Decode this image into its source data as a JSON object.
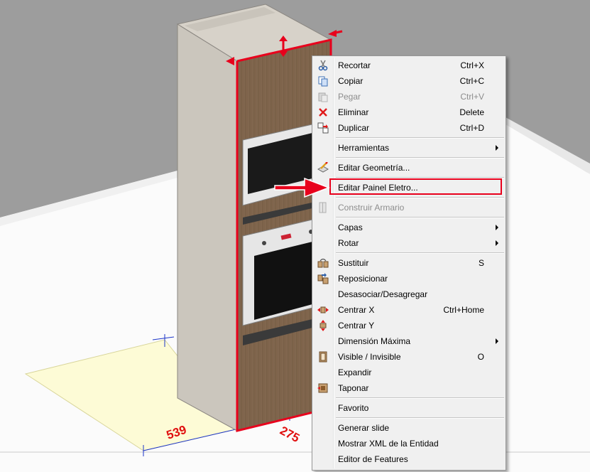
{
  "scene": {
    "dimension_width": "539",
    "dimension_depth": "275",
    "colors": {
      "highlight": "#e8001c",
      "menu_bg": "#f0f0f0"
    }
  },
  "menu": {
    "items": [
      {
        "label": "Recortar",
        "shortcut": "Ctrl+X",
        "icon": "scissors-icon"
      },
      {
        "label": "Copiar",
        "shortcut": "Ctrl+C",
        "icon": "copy-icon"
      },
      {
        "label": "Pegar",
        "shortcut": "Ctrl+V",
        "icon": "paste-icon",
        "disabled": true
      },
      {
        "label": "Eliminar",
        "shortcut": "Delete",
        "icon": "delete-icon"
      },
      {
        "label": "Duplicar",
        "shortcut": "Ctrl+D",
        "icon": "duplicate-icon"
      },
      {
        "label": "Herramientas",
        "submenu": true
      },
      {
        "label": "Editar Geometría...",
        "icon": "edit-geometry-icon"
      },
      {
        "label": "Editar Painel Eletro...",
        "highlighted": true
      },
      {
        "label": "Construir Armario",
        "icon": "build-cabinet-icon",
        "disabled": true
      },
      {
        "label": "Capas",
        "submenu": true
      },
      {
        "label": "Rotar",
        "submenu": true
      },
      {
        "label": "Sustituir",
        "shortcut": "S",
        "icon": "replace-icon"
      },
      {
        "label": "Reposicionar",
        "icon": "reposition-icon"
      },
      {
        "label": "Desasociar/Desagregar"
      },
      {
        "label": "Centrar X",
        "shortcut": "Ctrl+Home",
        "icon": "center-x-icon"
      },
      {
        "label": "Centrar Y",
        "icon": "center-y-icon"
      },
      {
        "label": "Dimensión Máxima",
        "submenu": true
      },
      {
        "label": "Visible / Invisible",
        "shortcut": "O",
        "icon": "visibility-icon"
      },
      {
        "label": "Expandir"
      },
      {
        "label": "Taponar",
        "icon": "plug-icon"
      },
      {
        "label": "Favorito"
      },
      {
        "label": "Generar slide"
      },
      {
        "label": "Mostrar XML de la Entidad"
      },
      {
        "label": "Editor de Features"
      }
    ]
  }
}
